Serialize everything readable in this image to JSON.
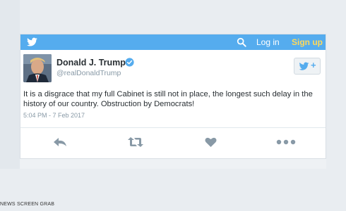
{
  "header": {
    "login_label": "Log in",
    "signup_label": "Sign up",
    "brand_color": "#55acee",
    "signup_color": "#ffd95a"
  },
  "tweet": {
    "author_name": "Donald J. Trump",
    "handle": "@realDonaldTrump",
    "text": "It is a disgrace that my full Cabinet is still not in place, the longest such delay in the history of our country. Obstruction by Democrats!",
    "timestamp": "5:04 PM - 7 Feb 2017",
    "verified": true
  },
  "follow_button": {
    "icon": "bird-add-icon",
    "plus": "+"
  },
  "actions": [
    "reply-icon",
    "retweet-icon",
    "like-icon",
    "more-icon"
  ],
  "watermark": "NEWS SCREEN GRAB"
}
